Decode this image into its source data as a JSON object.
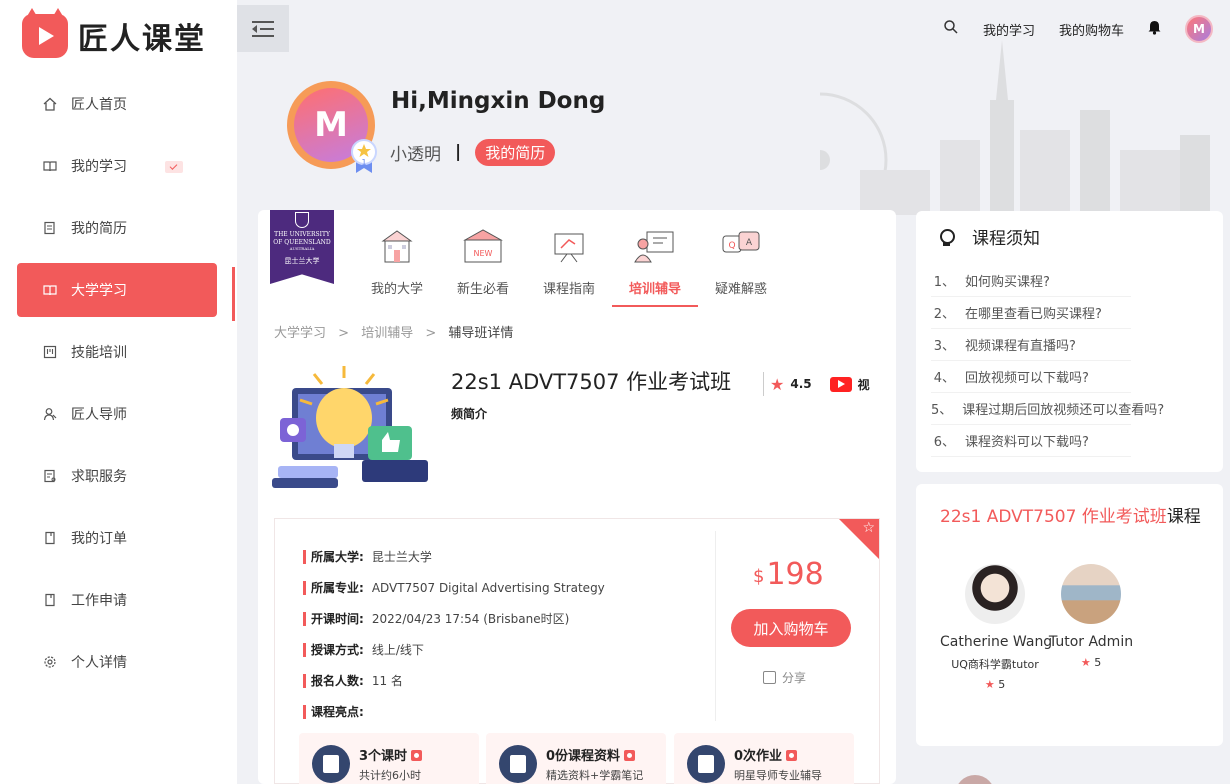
{
  "brand": {
    "name": "匠人课堂",
    "color": "#f25a5a"
  },
  "sidebar": {
    "items": [
      {
        "label": "匠人首页",
        "icon": "home-icon"
      },
      {
        "label": "我的学习",
        "icon": "book-icon"
      },
      {
        "label": "我的简历",
        "icon": "resume-icon"
      },
      {
        "label": "大学学习",
        "icon": "book-icon",
        "active": true
      },
      {
        "label": "技能培训",
        "icon": "training-icon"
      },
      {
        "label": "匠人导师",
        "icon": "mentor-icon"
      },
      {
        "label": "求职服务",
        "icon": "job-icon"
      },
      {
        "label": "我的订单",
        "icon": "order-icon"
      },
      {
        "label": "工作申请",
        "icon": "application-icon"
      },
      {
        "label": "个人详情",
        "icon": "gear-icon"
      }
    ]
  },
  "topbar": {
    "my_learning": "我的学习",
    "cart": "我的购物车",
    "avatar_letter": "M"
  },
  "profile": {
    "greeting": "Hi,Mingxin Dong",
    "avatar_letter": "M",
    "level": "小透明",
    "resume_button": "我的简历",
    "medal_number": "1"
  },
  "university": {
    "badge_line1": "THE UNIVERSITY",
    "badge_line2": "OF QUEENSLAND",
    "badge_line3": "AUSTRALIA",
    "badge_cn": "昆士兰大学"
  },
  "tabs": [
    {
      "label": "我的大学"
    },
    {
      "label": "新生必看"
    },
    {
      "label": "课程指南"
    },
    {
      "label": "培训辅导",
      "active": true
    },
    {
      "label": "疑难解惑"
    }
  ],
  "breadcrumb": [
    "大学学习",
    ">",
    "培训辅导",
    ">",
    "辅导班详情"
  ],
  "course": {
    "title": "22s1 ADVT7507 作业考试班",
    "rating": "4.5",
    "video_label_1": "视",
    "video_label_2": "频简介",
    "info": [
      {
        "key": "所属大学:",
        "value": "昆士兰大学"
      },
      {
        "key": "所属专业:",
        "value": "ADVT7507 Digital Advertising Strategy"
      },
      {
        "key": "开课时间:",
        "value": "2022/04/23 17:54 (Brisbane时区)"
      },
      {
        "key": "授课方式:",
        "value": "线上/线下"
      },
      {
        "key": "报名人数:",
        "value": "11 名"
      },
      {
        "key": "课程亮点:",
        "value": ""
      }
    ],
    "currency": "$",
    "price": "198",
    "add_to_cart": "加入购物车",
    "share": "分享",
    "stats": [
      {
        "title": "3个课时",
        "sub": "共计约6小时"
      },
      {
        "title": "0份课程资料",
        "sub": "精选资料+学霸笔记"
      },
      {
        "title": "0次作业",
        "sub": "明星导师专业辅导"
      }
    ]
  },
  "notice": {
    "title": "课程须知",
    "items": [
      {
        "n": "1、",
        "text": "如何购买课程?"
      },
      {
        "n": "2、",
        "text": "在哪里查看已购买课程?"
      },
      {
        "n": "3、",
        "text": "视频课程有直播吗?"
      },
      {
        "n": "4、",
        "text": "回放视频可以下载吗?"
      },
      {
        "n": "5、",
        "text": "课程过期后回放视频还可以查看吗?"
      },
      {
        "n": "6、",
        "text": "课程资料可以下载吗?"
      }
    ]
  },
  "tutors": {
    "title_highlight": "22s1 ADVT7507 作业考试班",
    "title_suffix": "课程",
    "list": [
      {
        "name": "Catherine Wang",
        "desc": "UQ商科学霸tutor",
        "rating": "5"
      },
      {
        "name": "Tutor Admin",
        "desc": "",
        "rating": "5"
      }
    ]
  }
}
